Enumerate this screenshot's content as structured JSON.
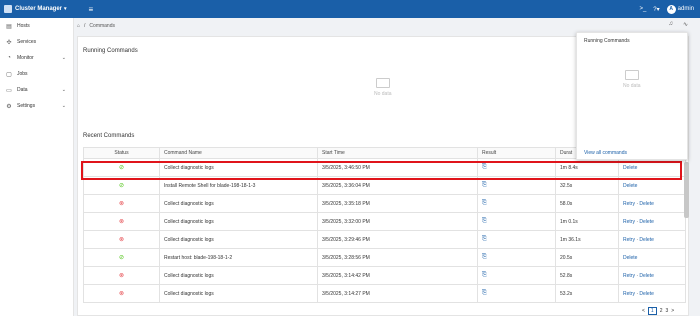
{
  "topbar": {
    "app_name": "Cluster Manager",
    "user": "admin",
    "avatar_letter": "A"
  },
  "sidebar": {
    "items": [
      {
        "label": "Hosts",
        "has_chevron": false
      },
      {
        "label": "Services",
        "has_chevron": false
      },
      {
        "label": "Monitor",
        "has_chevron": true
      },
      {
        "label": "Jobs",
        "has_chevron": false
      },
      {
        "label": "Data",
        "has_chevron": true
      },
      {
        "label": "Settings",
        "has_chevron": true
      }
    ]
  },
  "breadcrumb": {
    "current": "Commands"
  },
  "running": {
    "title": "Running Commands",
    "empty_text": "No data"
  },
  "recent": {
    "title": "Recent Commands",
    "columns": [
      "Status",
      "Command Name",
      "Start Time",
      "Result",
      "Durat"
    ],
    "rows": [
      {
        "status": "success",
        "name": "Collect diagnostic logs",
        "start": "3/5/2025, 3:46:50 PM",
        "duration": "1m 8.4s",
        "actions": [
          "Delete"
        ]
      },
      {
        "status": "success",
        "name": "Install Remote Shell for blade-198-18-1-3",
        "start": "3/5/2025, 3:36:04 PM",
        "duration": "32.5s",
        "actions": [
          "Delete"
        ]
      },
      {
        "status": "failed",
        "name": "Collect diagnostic logs",
        "start": "3/5/2025, 3:35:18 PM",
        "duration": "58.0s",
        "actions": [
          "Retry",
          "Delete"
        ]
      },
      {
        "status": "failed",
        "name": "Collect diagnostic logs",
        "start": "3/5/2025, 3:32:00 PM",
        "duration": "1m 0.1s",
        "actions": [
          "Retry",
          "Delete"
        ]
      },
      {
        "status": "failed",
        "name": "Collect diagnostic logs",
        "start": "3/5/2025, 3:29:46 PM",
        "duration": "1m 36.1s",
        "actions": [
          "Retry",
          "Delete"
        ]
      },
      {
        "status": "success",
        "name": "Restart host: blade-198-18-1-2",
        "start": "3/5/2025, 3:28:56 PM",
        "duration": "20.5s",
        "actions": [
          "Delete"
        ]
      },
      {
        "status": "failed",
        "name": "Collect diagnostic logs",
        "start": "3/5/2025, 3:14:42 PM",
        "duration": "52.8s",
        "actions": [
          "Retry",
          "Delete"
        ]
      },
      {
        "status": "failed",
        "name": "Collect diagnostic logs",
        "start": "3/5/2025, 3:14:27 PM",
        "duration": "53.2s",
        "actions": [
          "Retry",
          "Delete"
        ]
      }
    ]
  },
  "popup": {
    "title": "Running Commands",
    "empty_text": "No data",
    "footer_link": "View all commands"
  },
  "pager": {
    "prev": "<",
    "pages": [
      "1",
      "2",
      "3"
    ],
    "next": ">",
    "current": "1"
  },
  "colors": {
    "topbar": "#1a5fa8",
    "success": "#52c41a",
    "error": "#e5484d",
    "highlight": "#e0141b"
  }
}
